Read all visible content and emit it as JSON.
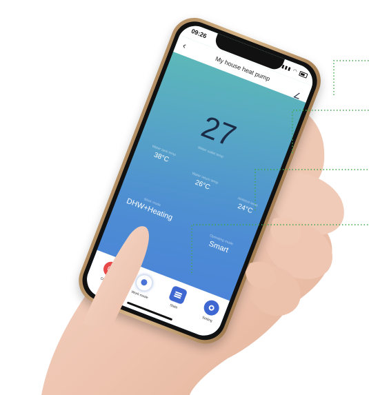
{
  "status_bar": {
    "time": "09:26",
    "signal_icon": "signal-icon",
    "wifi_icon": "wifi-icon",
    "battery_icon": "battery-icon"
  },
  "header": {
    "back_icon": "chevron-left-icon",
    "title": "My house heat pump",
    "edit_icon": "edit-icon"
  },
  "main_reading": {
    "value": "27",
    "label": "Water outlet temp"
  },
  "readings": [
    {
      "label": "Water tank temp",
      "value": "38°C"
    },
    {
      "label": "Water return temp",
      "value": "26°C"
    },
    {
      "label": "Ambient temp",
      "value": "24°C"
    }
  ],
  "work_mode": {
    "label": "Work mode",
    "value": "DHW+Heating"
  },
  "operating_mode": {
    "label": "Operating mode",
    "value": "Smart"
  },
  "tabs": [
    {
      "label": "ON/OFF",
      "icon": "power-icon"
    },
    {
      "label": "Work mode",
      "icon": "mode-icon"
    },
    {
      "label": "State",
      "icon": "list-icon"
    },
    {
      "label": "Setting",
      "icon": "gear-icon"
    }
  ],
  "colors": {
    "screen_top": "#5fc0b2",
    "screen_bottom": "#4a7fdb",
    "callout_line": "#3aa845",
    "power_button": "#e84a4a",
    "accent_blue": "#3f67d2"
  }
}
